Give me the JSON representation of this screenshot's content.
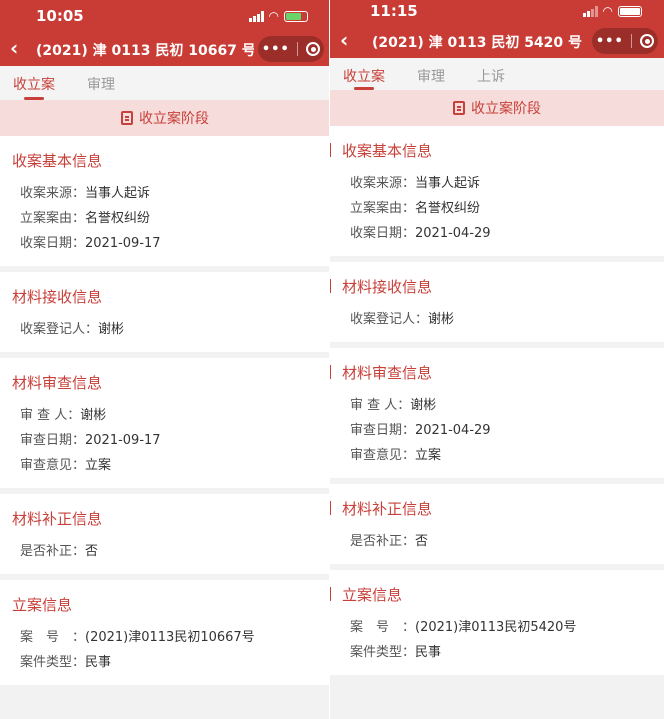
{
  "phones": [
    {
      "status": {
        "time": "10:05"
      },
      "nav": {
        "back": "‹",
        "title": "(2021) 津 0113 民初 10667 号",
        "more": "•••"
      },
      "tabs": [
        {
          "label": "收立案"
        },
        {
          "label": "审理"
        }
      ],
      "stage": {
        "label": "收立案阶段"
      },
      "sections": [
        {
          "title": "收案基本信息",
          "rows": [
            {
              "label": "收案来源：",
              "value": "当事人起诉"
            },
            {
              "label": "立案案由：",
              "value": "名誉权纠纷"
            },
            {
              "label": "收案日期：",
              "value": "2021-09-17"
            }
          ]
        },
        {
          "title": "材料接收信息",
          "rows": [
            {
              "label": "收案登记人：",
              "value": "谢彬"
            }
          ]
        },
        {
          "title": "材料审查信息",
          "rows": [
            {
              "label": "审 查 人：",
              "value": "谢彬"
            },
            {
              "label": "审查日期：",
              "value": "2021-09-17"
            },
            {
              "label": "审查意见：",
              "value": "立案"
            }
          ]
        },
        {
          "title": "材料补正信息",
          "rows": [
            {
              "label": "是否补正：",
              "value": "否"
            }
          ]
        },
        {
          "title": "立案信息",
          "rows": [
            {
              "label": "案　号　：",
              "value": "(2021)津0113民初10667号"
            },
            {
              "label": "案件类型：",
              "value": "民事"
            }
          ]
        }
      ]
    },
    {
      "status": {
        "time": "11:15"
      },
      "nav": {
        "back": "‹",
        "title": "(2021) 津 0113 民初 5420 号",
        "more": "•••"
      },
      "tabs": [
        {
          "label": "收立案"
        },
        {
          "label": "审理"
        },
        {
          "label": "上诉"
        }
      ],
      "stage": {
        "label": "收立案阶段"
      },
      "sections": [
        {
          "title": "收案基本信息",
          "rows": [
            {
              "label": "收案来源：",
              "value": "当事人起诉"
            },
            {
              "label": "立案案由：",
              "value": "名誉权纠纷"
            },
            {
              "label": "收案日期：",
              "value": "2021-04-29"
            }
          ]
        },
        {
          "title": "材料接收信息",
          "rows": [
            {
              "label": "收案登记人：",
              "value": "谢彬"
            }
          ]
        },
        {
          "title": "材料审查信息",
          "rows": [
            {
              "label": "审 查 人：",
              "value": "谢彬"
            },
            {
              "label": "审查日期：",
              "value": "2021-04-29"
            },
            {
              "label": "审查意见：",
              "value": "立案"
            }
          ]
        },
        {
          "title": "材料补正信息",
          "rows": [
            {
              "label": "是否补正：",
              "value": "否"
            }
          ]
        },
        {
          "title": "立案信息",
          "rows": [
            {
              "label": "案　号　：",
              "value": "(2021)津0113民初5420号"
            },
            {
              "label": "案件类型：",
              "value": "民事"
            }
          ]
        }
      ]
    }
  ]
}
